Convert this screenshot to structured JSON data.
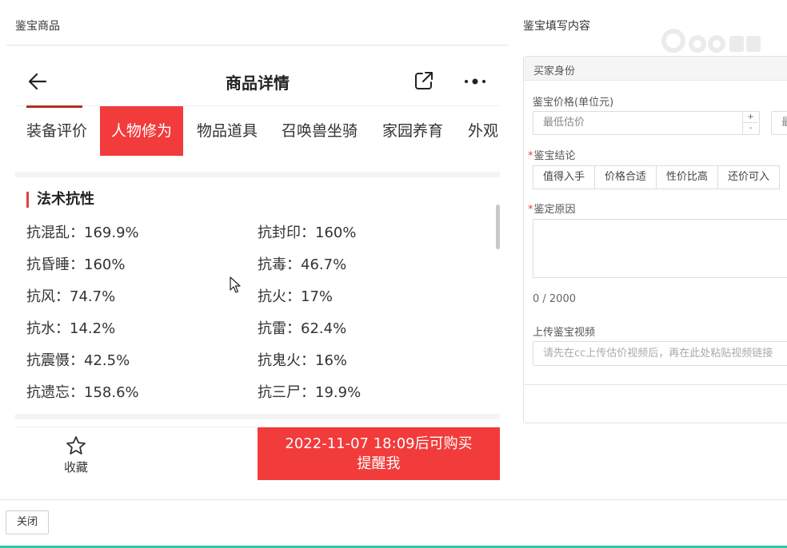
{
  "left_pane": {
    "title": "鉴宝商品"
  },
  "right_pane": {
    "title": "鉴宝填写内容",
    "logo_icon": "cc-watermark-logo"
  },
  "phone": {
    "header": {
      "title": "商品详情",
      "back_icon": "arrow-left-icon",
      "share_icon": "share-icon",
      "more_icon": "more-dots-icon"
    },
    "tabs": [
      {
        "label": "装备评价"
      },
      {
        "label": "人物修为",
        "active": true
      },
      {
        "label": "物品道具"
      },
      {
        "label": "召唤兽坐骑"
      },
      {
        "label": "家园养育"
      },
      {
        "label": "外观"
      }
    ],
    "section": {
      "title": "法术抗性",
      "stats": [
        {
          "label": "抗混乱：169.9%"
        },
        {
          "label": "抗封印：160%"
        },
        {
          "label": "抗昏睡：160%"
        },
        {
          "label": "抗毒：46.7%"
        },
        {
          "label": "抗风：74.7%"
        },
        {
          "label": "抗火：17%"
        },
        {
          "label": "抗水：14.2%"
        },
        {
          "label": "抗雷：62.4%"
        },
        {
          "label": "抗震慑：42.5%"
        },
        {
          "label": "抗鬼火：16%"
        },
        {
          "label": "抗遗忘：158.6%"
        },
        {
          "label": "抗三尸：19.9%"
        }
      ]
    },
    "favorite": {
      "label": "收藏",
      "icon": "star-icon"
    },
    "buy_button": {
      "line1": "2022-11-07 18:09后可购买",
      "line2": "提醒我"
    }
  },
  "form": {
    "card_header": "买家身份",
    "price": {
      "label": "鉴宝价格(单位元)",
      "min_placeholder": "最低估价",
      "max_placeholder_fragment": "最",
      "plus": "+",
      "minus": "-"
    },
    "conclusion": {
      "required_mark": "*",
      "label": "鉴宝结论",
      "options": [
        "值得入手",
        "价格合适",
        "性价比高",
        "还价可入"
      ]
    },
    "reason": {
      "required_mark": "*",
      "label": "鉴定原因",
      "counter": "0 / 2000"
    },
    "video": {
      "label": "上传鉴宝视频",
      "placeholder": "请先在cc上传估价视频后，再在此处粘贴视频链接"
    }
  },
  "footer": {
    "close_label": "关闭"
  },
  "colors": {
    "accent_red": "#f23b3b",
    "bottom_accent": "#31c7a8"
  }
}
